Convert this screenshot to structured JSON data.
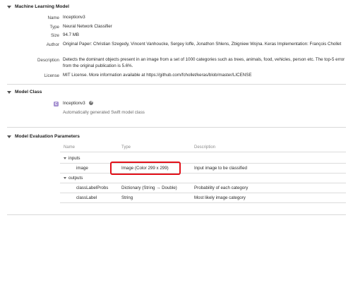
{
  "ml_model": {
    "section_title": "Machine Learning Model",
    "fields": [
      {
        "label": "Name",
        "value": "Inceptionv3"
      },
      {
        "label": "Type",
        "value": "Neural Network Classifier"
      },
      {
        "label": "Size",
        "value": "94.7 MB"
      },
      {
        "label": "Author",
        "value": "Original Paper: Christian Szegedy, Vincent Vanhoucke, Sergey Ioffe, Jonathon Shlens, Zbigniew Wojna. Keras Implementation: François Chollet"
      },
      {
        "label": "Description",
        "value": "Detects the dominant objects present in an image from a set of 1000 categories such as trees, animals, food, vehicles, person etc. The top-5 error from the original publication is 5.6%."
      },
      {
        "label": "License",
        "value": "MIT License. More information available at https://github.com/fchollet/keras/blob/master/LICENSE"
      }
    ]
  },
  "model_class": {
    "section_title": "Model Class",
    "class_icon_letter": "C",
    "class_name": "Inceptionv3",
    "class_note": "Automatically generated Swift model class"
  },
  "evaluation": {
    "section_title": "Model Evaluation Parameters",
    "headers": {
      "name": "Name",
      "type": "Type",
      "description": "Description"
    },
    "inputs_label": "inputs",
    "outputs_label": "outputs",
    "inputs": [
      {
        "name": "image",
        "type": "Image (Color 299 x 299)",
        "description": "Input image to be classified"
      }
    ],
    "outputs": [
      {
        "name": "classLabelProbs",
        "type": "Dictionary (String → Double)",
        "description": "Probability of each category"
      },
      {
        "name": "classLabel",
        "type": "String",
        "description": "Most likely image category"
      }
    ]
  }
}
